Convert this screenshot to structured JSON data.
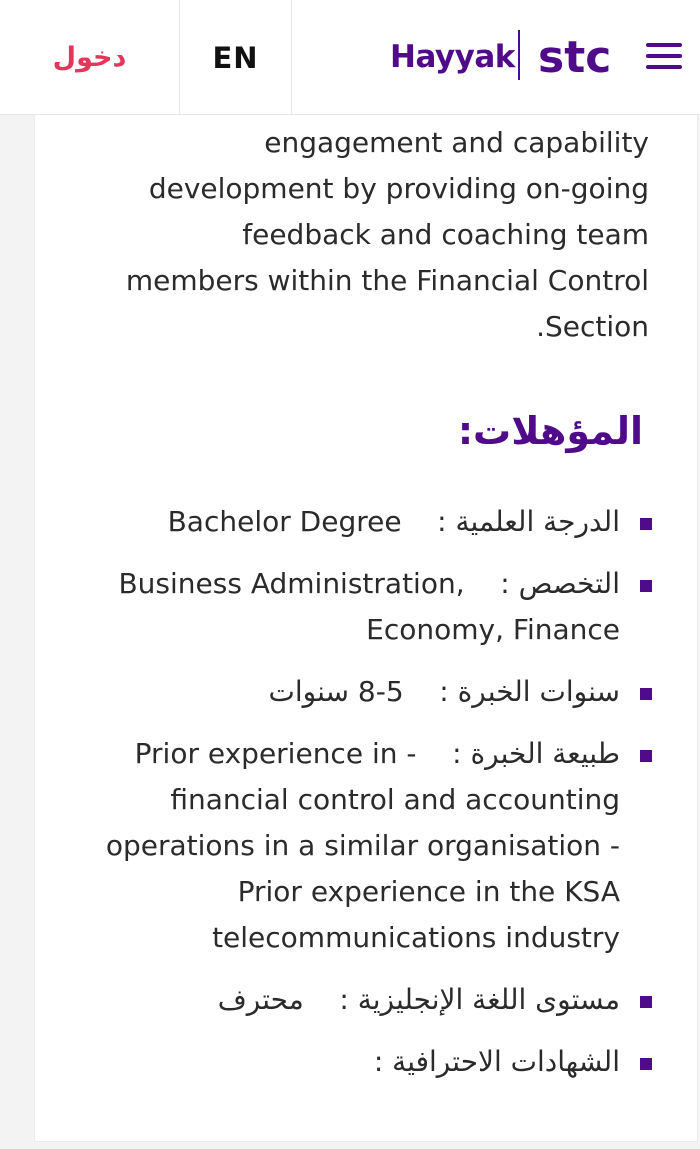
{
  "header": {
    "login_label": "دخول",
    "lang_label": "EN",
    "brand_hayyak": "Hayyak",
    "brand_stc": "stc",
    "brand_color": "#4f0b8a",
    "login_color": "#e3365b",
    "menu_icon": "hamburger-menu-icon"
  },
  "content": {
    "intro_lines": [
      "engagement and capability",
      "development by providing on-going",
      "feedback and coaching team",
      "members within the Financial Control",
      "Section."
    ],
    "qualifications_title": "المؤهلات:",
    "qualifications": [
      {
        "label": "الدرجة العلمية :",
        "value": "Bachelor Degree"
      },
      {
        "label": "التخصص :",
        "value": "Business Administration, Economy, Finance"
      },
      {
        "label": "سنوات الخبرة :",
        "value": "5-8 سنوات"
      },
      {
        "label": "طبيعة الخبرة :",
        "value": "- Prior experience in financial control and accounting operations in a similar organisation - Prior experience in the KSA telecommunications industry"
      },
      {
        "label": "مستوى اللغة الإنجليزية :",
        "value": "محترف"
      },
      {
        "label": "الشهادات الاحترافية :",
        "value": ""
      }
    ]
  }
}
